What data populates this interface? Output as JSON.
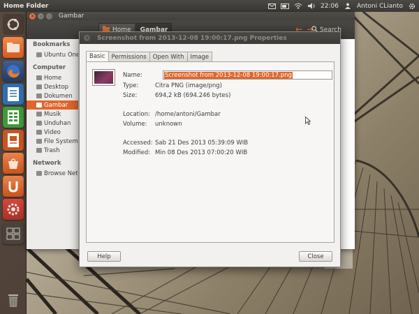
{
  "top_panel": {
    "title": "Home Folder",
    "clock": "22:06",
    "user": "Antoni CLianto",
    "tray_icons": [
      "mail-icon",
      "battery-icon",
      "wifi-icon",
      "volume-icon",
      "gear-icon"
    ]
  },
  "launcher": {
    "items": [
      "ubuntu-dash-icon",
      "files-icon",
      "firefox-icon",
      "writer-icon",
      "calc-icon",
      "impress-icon",
      "software-center-icon",
      "ubuntu-one-icon",
      "system-settings-icon",
      "workspace-switcher-icon",
      "trash-icon"
    ]
  },
  "nautilus": {
    "window_title": "Gambar",
    "breadcrumbs": [
      {
        "label": "Home"
      },
      {
        "label": "Gambar"
      }
    ],
    "search_label": "Search",
    "sidebar": {
      "sections": [
        {
          "heading": "Bookmarks",
          "items": [
            "Ubuntu One"
          ]
        },
        {
          "heading": "Computer",
          "items": [
            "Home",
            "Desktop",
            "Dokumen",
            "Gambar",
            "Musik",
            "Unduhan",
            "Video",
            "File System",
            "Trash"
          ]
        },
        {
          "heading": "Network",
          "items": [
            "Browse Net..."
          ]
        }
      ],
      "active_item": "Gambar"
    }
  },
  "properties": {
    "title": "Screenshot from 2013-12-08 19:00:17.png Properties",
    "tabs": [
      "Basic",
      "Permissions",
      "Open With",
      "Image"
    ],
    "active_tab": "Basic",
    "fields": {
      "name_label": "Name:",
      "name_value": "Screenshot from 2013-12-08 19:00:17.png",
      "type_label": "Type:",
      "type_value": "Citra PNG (image/png)",
      "size_label": "Size:",
      "size_value": "694,2 kB (694.246 bytes)",
      "location_label": "Location:",
      "location_value": "/home/antoni/Gambar",
      "volume_label": "Volume:",
      "volume_value": "unknown",
      "accessed_label": "Accessed:",
      "accessed_value": "Sab 21 Des 2013 05:39:09  WIB",
      "modified_label": "Modified:",
      "modified_value": "Min 08 Des 2013 07:00:20  WIB"
    },
    "help_label": "Help",
    "close_label": "Close"
  },
  "colors": {
    "accent": "#e0662e",
    "panel": "#3c3b37",
    "dialog_bg": "#f2f1f0"
  }
}
